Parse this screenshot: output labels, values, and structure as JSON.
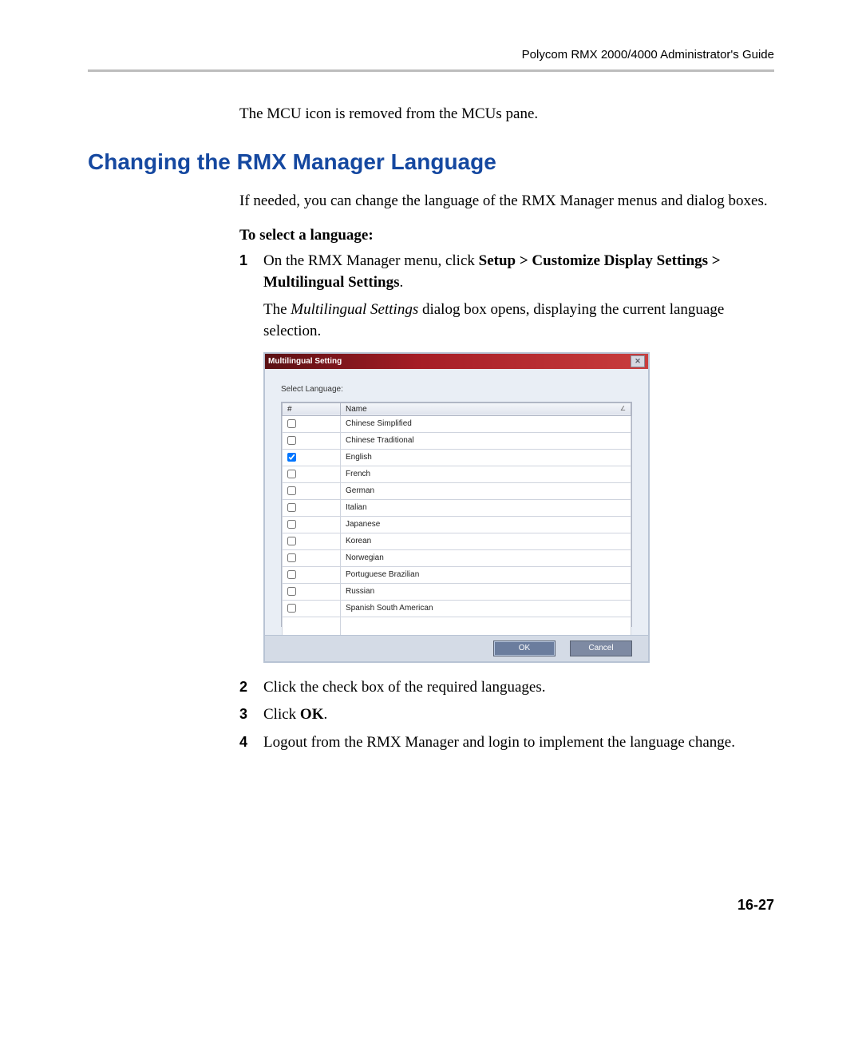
{
  "header": {
    "doc_title": "Polycom RMX 2000/4000 Administrator's Guide"
  },
  "intro": "The MCU icon is removed from the MCUs pane.",
  "heading": "Changing the RMX Manager Language",
  "body1": "If needed, you can change the language of the RMX Manager menus and dialog boxes.",
  "subheading": "To select a language:",
  "step1_a": "On the RMX Manager menu, click ",
  "step1_b": "Setup > Customize Display Settings > Multilingual Settings",
  "step1_c": ".",
  "step1_follow_a": "The ",
  "step1_follow_b": "Multilingual Settings",
  "step1_follow_c": " dialog box opens, displaying the current language selection.",
  "dialog": {
    "title": "Multilingual Setting",
    "close_glyph": "✕",
    "select_label": "Select Language:",
    "col_hash": "#",
    "col_name": "Name",
    "languages": [
      {
        "checked": false,
        "name": "Chinese Simplified"
      },
      {
        "checked": false,
        "name": "Chinese Traditional"
      },
      {
        "checked": true,
        "name": "English"
      },
      {
        "checked": false,
        "name": "French"
      },
      {
        "checked": false,
        "name": "German"
      },
      {
        "checked": false,
        "name": "Italian"
      },
      {
        "checked": false,
        "name": "Japanese"
      },
      {
        "checked": false,
        "name": "Korean"
      },
      {
        "checked": false,
        "name": "Norwegian"
      },
      {
        "checked": false,
        "name": "Portuguese Brazilian"
      },
      {
        "checked": false,
        "name": "Russian"
      },
      {
        "checked": false,
        "name": "Spanish South American"
      }
    ],
    "ok": "OK",
    "cancel": "Cancel"
  },
  "step2": "Click the check box of the required languages.",
  "step3_a": "Click ",
  "step3_b": "OK",
  "step3_c": ".",
  "step4": "Logout from the RMX Manager and login to implement the language change.",
  "page_number": "16-27",
  "nums": {
    "n1": "1",
    "n2": "2",
    "n3": "3",
    "n4": "4"
  }
}
